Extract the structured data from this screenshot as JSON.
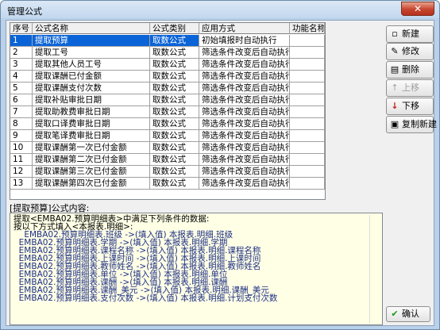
{
  "window": {
    "title": "管理公式",
    "close_glyph": "✕"
  },
  "table": {
    "headers": [
      "序号",
      "公式名称",
      "公式类别",
      "应用方式",
      "功能名称"
    ],
    "rows": [
      {
        "no": "1",
        "name": "提取预算",
        "category": "取数公式",
        "mode": "初始填报时自动执行",
        "func": ""
      },
      {
        "no": "2",
        "name": "提取工号",
        "category": "取数公式",
        "mode": "筛选条件改变后自动执行",
        "func": ""
      },
      {
        "no": "3",
        "name": "提取其他人员工号",
        "category": "取数公式",
        "mode": "筛选条件改变后自动执行",
        "func": ""
      },
      {
        "no": "4",
        "name": "提取课酬已付金额",
        "category": "取数公式",
        "mode": "筛选条件改变后自动执行",
        "func": ""
      },
      {
        "no": "5",
        "name": "提取课酬支付次数",
        "category": "取数公式",
        "mode": "筛选条件改变后自动执行",
        "func": ""
      },
      {
        "no": "6",
        "name": "提取补贴审批日期",
        "category": "取数公式",
        "mode": "筛选条件改变后自动执行",
        "func": ""
      },
      {
        "no": "7",
        "name": "提取助教费审批日期",
        "category": "取数公式",
        "mode": "筛选条件改变后自动执行",
        "func": ""
      },
      {
        "no": "8",
        "name": "提取口译费审批日期",
        "category": "取数公式",
        "mode": "筛选条件改变后自动执行",
        "func": ""
      },
      {
        "no": "9",
        "name": "提取笔译费审批日期",
        "category": "取数公式",
        "mode": "筛选条件改变后自动执行",
        "func": ""
      },
      {
        "no": "10",
        "name": "提取课酬第一次已付金额",
        "category": "取数公式",
        "mode": "筛选条件改变后自动执行",
        "func": ""
      },
      {
        "no": "11",
        "name": "提取课酬第二次已付金额",
        "category": "取数公式",
        "mode": "筛选条件改变后自动执行",
        "func": ""
      },
      {
        "no": "12",
        "name": "提取课酬第三次已付金额",
        "category": "取数公式",
        "mode": "筛选条件改变后自动执行",
        "func": ""
      },
      {
        "no": "13",
        "name": "提取课酬第四次已付金额",
        "category": "取数公式",
        "mode": "筛选条件改变后自动执行",
        "func": ""
      }
    ]
  },
  "buttons": {
    "new": {
      "label": "新建",
      "icon": "new-doc-icon"
    },
    "edit": {
      "label": "修改",
      "icon": "edit-icon"
    },
    "delete": {
      "label": "删除",
      "icon": "delete-icon"
    },
    "up": {
      "label": "上移",
      "icon": "arrow-up-icon"
    },
    "down": {
      "label": "下移",
      "icon": "arrow-down-icon"
    },
    "copy": {
      "label": "复制新建",
      "icon": "copy-icon"
    },
    "ok": {
      "label": "确认",
      "icon": "check-icon"
    }
  },
  "content": {
    "label": "[提取预算]公式内容:",
    "lines": [
      "提取<EMBA02.预算明细表>中满足下列条件的数据:",
      "按以下方式填入<本报表.明细>:",
      "    EMBA02.预算明细表.班级 ->(填入值) 本报表.明细.班级",
      "  EMBA02.预算明细表.学期 ->(填入值) 本报表.明细.学期",
      "  EMBA02.预算明细表.课程名称 ->(填入值) 本报表.明细.课程名称",
      "  EMBA02.预算明细表.上课时间 ->(填入值) 本报表.明细.上课时间",
      "  EMBA02.预算明细表.教师姓名 ->(填入值) 本报表.明细.教师姓名",
      "  EMBA02.预算明细表.单位 ->(填入值) 本报表.明细.单位",
      "  EMBA02.预算明细表.课酬 ->(填入值) 本报表.明细.课酬",
      "  EMBA02.预算明细表.课酬_美元 ->(填入值) 本报表.明细.课酬_美元",
      "  EMBA02.预算明细表.支付次数 ->(填入值) 本报表.明细.计划支付次数"
    ]
  }
}
